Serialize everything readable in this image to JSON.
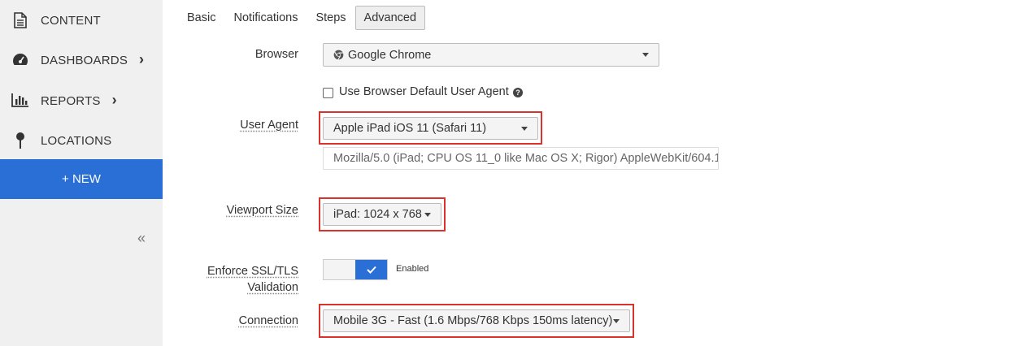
{
  "sidebar": {
    "items": [
      {
        "label": "CONTENT",
        "icon": "document-icon"
      },
      {
        "label": "DASHBOARDS",
        "icon": "dashboard-gauge-icon",
        "chevron": "›"
      },
      {
        "label": "REPORTS",
        "icon": "bar-chart-icon",
        "chevron": "›"
      },
      {
        "label": "LOCATIONS",
        "icon": "map-pin-icon"
      }
    ],
    "new_label": "+ NEW",
    "collapse_glyph": "«",
    "accent_color": "#2a6fd6"
  },
  "tabs": [
    {
      "label": "Basic"
    },
    {
      "label": "Notifications"
    },
    {
      "label": "Steps"
    },
    {
      "label": "Advanced",
      "active": true
    }
  ],
  "form": {
    "browser": {
      "label": "Browser",
      "value": "Google Chrome"
    },
    "default_ua": {
      "label": "Use Browser Default User Agent",
      "checked": false
    },
    "user_agent": {
      "label": "User Agent",
      "value": "Apple iPad iOS 11 (Safari 11)",
      "string": "Mozilla/5.0 (iPad; CPU OS 11_0 like Mac OS X; Rigor) AppleWebKit/604.1"
    },
    "viewport": {
      "label": "Viewport Size",
      "value": "iPad: 1024 x 768"
    },
    "ssl": {
      "label_line1": "Enforce SSL/TLS",
      "label_line2": "Validation",
      "state": "Enabled"
    },
    "connection": {
      "label": "Connection",
      "value": "Mobile 3G - Fast (1.6 Mbps/768 Kbps 150ms latency)"
    }
  },
  "highlight_color": "#d9342b"
}
